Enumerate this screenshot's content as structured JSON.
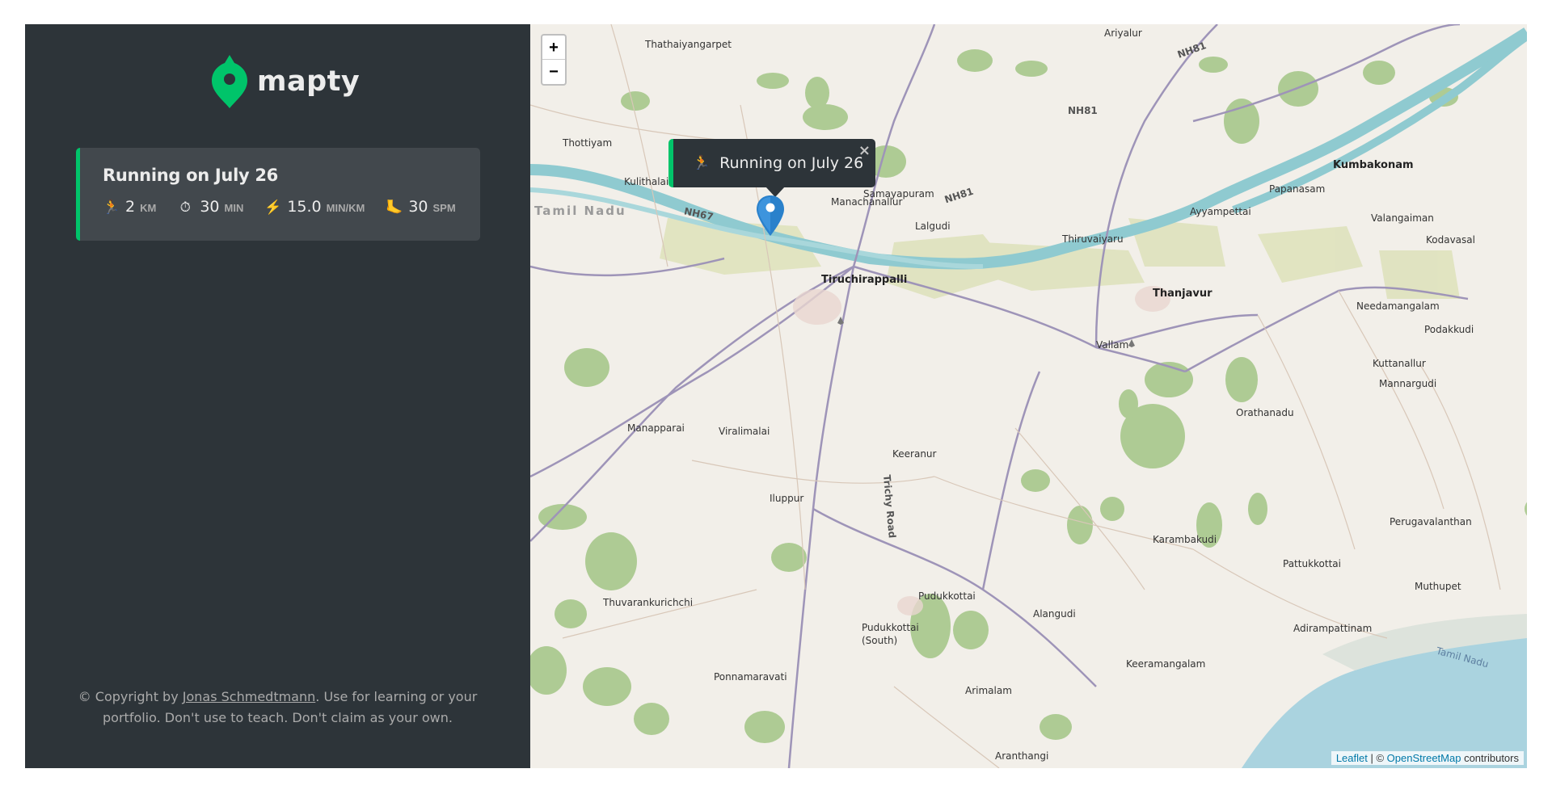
{
  "app": {
    "logo_text": "mapty"
  },
  "workout": {
    "title": "Running on July 26",
    "accent_color": "#00c46a",
    "details": [
      {
        "icon": "runner-icon",
        "glyph": "🏃",
        "value": "2",
        "unit": "km"
      },
      {
        "icon": "stopwatch-icon",
        "glyph": "⏱",
        "value": "30",
        "unit": "min"
      },
      {
        "icon": "lightning-icon",
        "glyph": "⚡",
        "value": "15.0",
        "unit": "min/km"
      },
      {
        "icon": "footprint-icon",
        "glyph": "🦶",
        "value": "30",
        "unit": "spm"
      }
    ]
  },
  "copyright": {
    "prefix": "© Copyright by ",
    "author": "Jonas Schmedtmann",
    "suffix": ". Use for learning or your portfolio. Don't use to teach. Don't claim as your own."
  },
  "map": {
    "zoom_in": "+",
    "zoom_out": "−",
    "popup": {
      "glyph": "🏃",
      "text": "Running on July 26",
      "close": "×"
    },
    "attribution": {
      "leaflet": "Leaflet",
      "separator": " | © ",
      "osm": "OpenStreetMap",
      "suffix": " contributors"
    },
    "places": [
      {
        "name": "Thathaiyangarpet"
      },
      {
        "name": "Ariyalur"
      },
      {
        "name": "NH81"
      },
      {
        "name": "NH81"
      },
      {
        "name": "NH81"
      },
      {
        "name": "Thottiyam"
      },
      {
        "name": "Kulithalai"
      },
      {
        "name": "Tamil Nadu"
      },
      {
        "name": "NH67"
      },
      {
        "name": "Manachanallur"
      },
      {
        "name": "Samayapuram"
      },
      {
        "name": "Lalgudi"
      },
      {
        "name": "Kumbakonam"
      },
      {
        "name": "Papanasam"
      },
      {
        "name": "Ayyampettai"
      },
      {
        "name": "Valangaiman"
      },
      {
        "name": "Kodavasal"
      },
      {
        "name": "Thiruvaiyaru"
      },
      {
        "name": "Tiruchirappalli"
      },
      {
        "name": "Thanjavur"
      },
      {
        "name": "Needamangalam"
      },
      {
        "name": "Podakkudi"
      },
      {
        "name": "Vallam"
      },
      {
        "name": "Kuttanallur"
      },
      {
        "name": "Mannargudi"
      },
      {
        "name": "Orathanadu"
      },
      {
        "name": "Manapparai"
      },
      {
        "name": "Viralimalai"
      },
      {
        "name": "Keeranur"
      },
      {
        "name": "Trichy Road"
      },
      {
        "name": "Iluppur"
      },
      {
        "name": "Karambakudi"
      },
      {
        "name": "Perugavalanthan"
      },
      {
        "name": "Pattukkottai"
      },
      {
        "name": "Muthupet"
      },
      {
        "name": "Thuvarankurichchi"
      },
      {
        "name": "Pudukkottai"
      },
      {
        "name": "Alangudi"
      },
      {
        "name": "Pudukkottai (South)"
      },
      {
        "name": "Adirampattinam"
      },
      {
        "name": "Tamil Nadu"
      },
      {
        "name": "Ponnamaravati"
      },
      {
        "name": "Keeramangalam"
      },
      {
        "name": "Arimalam"
      },
      {
        "name": "Aranthangi"
      }
    ]
  }
}
